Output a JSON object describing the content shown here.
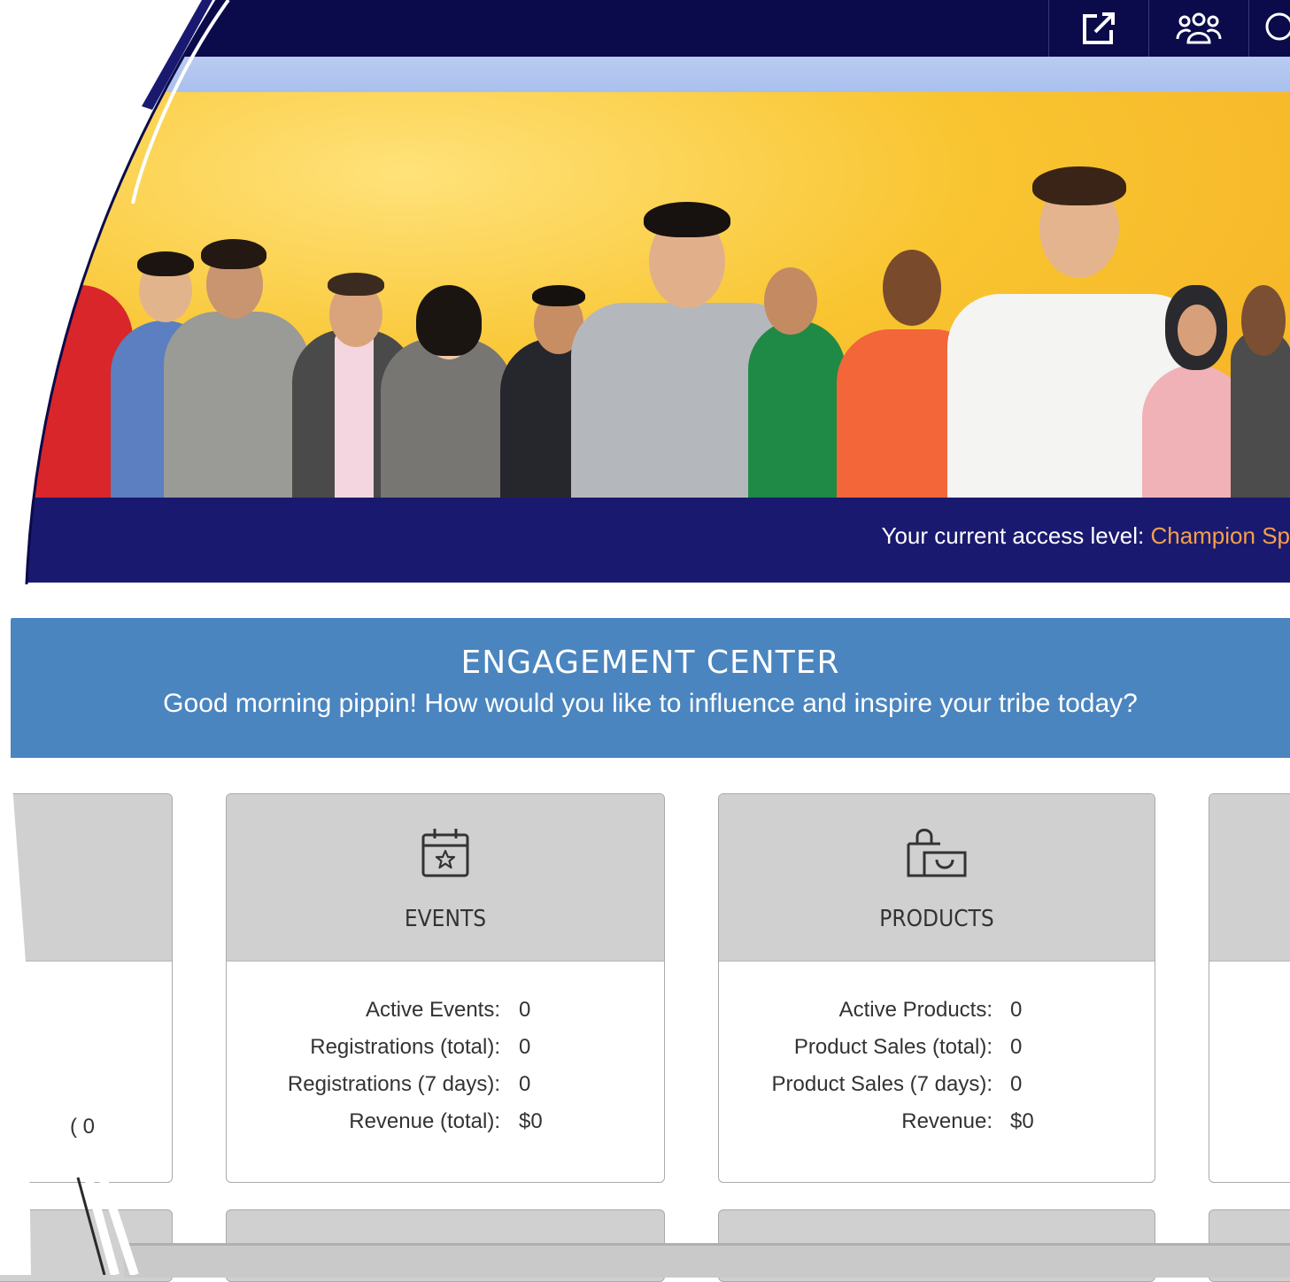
{
  "topbar": {
    "icons": [
      "external-link-icon",
      "users-icon",
      "search-icon"
    ]
  },
  "access": {
    "prefix": "Your current access level: ",
    "level": "Champion Sp"
  },
  "engagement": {
    "title": "ENGAGEMENT CENTER",
    "subtitle": "Good morning pippin! How would you like to influence and inspire your tribe today?"
  },
  "cards": {
    "partial_left_value": "  0",
    "events": {
      "title": "EVENTS",
      "icon": "calendar-star-icon",
      "rows": [
        {
          "label": "Active Events:",
          "value": "0"
        },
        {
          "label": "Registrations (total):",
          "value": "0"
        },
        {
          "label": "Registrations (7 days):",
          "value": "0"
        },
        {
          "label": "Revenue (total):",
          "value": "$0"
        }
      ]
    },
    "products": {
      "title": "PRODUCTS",
      "icon": "shopping-bag-icon",
      "rows": [
        {
          "label": "Active Products:",
          "value": "0"
        },
        {
          "label": "Product Sales (total):",
          "value": "0"
        },
        {
          "label": "Product Sales (7 days):",
          "value": "0"
        },
        {
          "label": "Revenue:",
          "value": "$0"
        }
      ]
    }
  },
  "colors": {
    "topbar": "#0b0a4a",
    "access_bar": "#1a1970",
    "access_level": "#f5a04a",
    "engagement_header": "#4a85bf",
    "card_head": "#d0d0d0"
  }
}
